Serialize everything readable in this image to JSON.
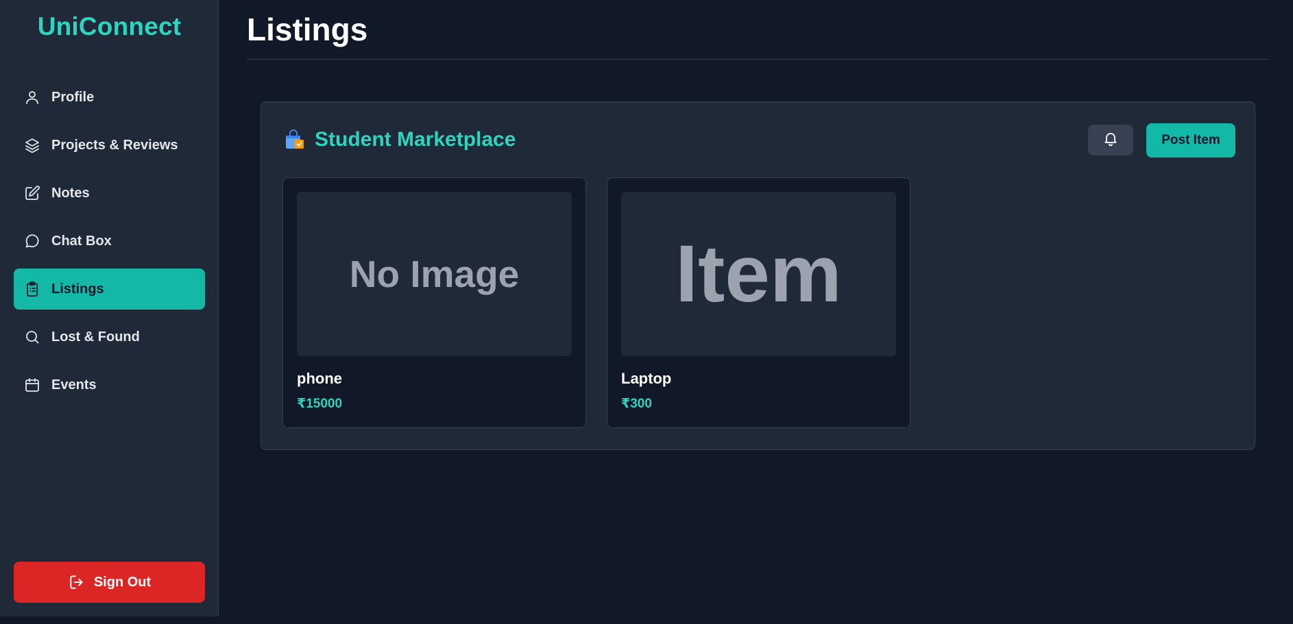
{
  "app": {
    "brand": "UniConnect"
  },
  "sidebar": {
    "items": [
      {
        "label": "Profile",
        "icon": "user-icon"
      },
      {
        "label": "Projects & Reviews",
        "icon": "layers-icon"
      },
      {
        "label": "Notes",
        "icon": "edit-icon"
      },
      {
        "label": "Chat Box",
        "icon": "chat-bubble-icon"
      },
      {
        "label": "Listings",
        "icon": "clipboard-list-icon",
        "active": true
      },
      {
        "label": "Lost & Found",
        "icon": "search-icon"
      },
      {
        "label": "Events",
        "icon": "calendar-icon"
      }
    ],
    "sign_out": {
      "label": "Sign Out",
      "icon": "logout-icon"
    }
  },
  "page": {
    "title": "Listings"
  },
  "marketplace": {
    "title": "Student Marketplace",
    "title_icon": "shopping-bag-icon",
    "bell_icon": "bell-icon",
    "post_label": "Post Item",
    "listings": [
      {
        "image_text": "No Image",
        "name": "phone",
        "price": "₹15000"
      },
      {
        "image_text": "Item",
        "name": "Laptop",
        "price": "₹300"
      }
    ]
  },
  "colors": {
    "background": "#111827",
    "panel": "#1f2937",
    "accent": "#14b8a6",
    "accent_text": "#2dd4bf",
    "danger": "#dc2626"
  }
}
